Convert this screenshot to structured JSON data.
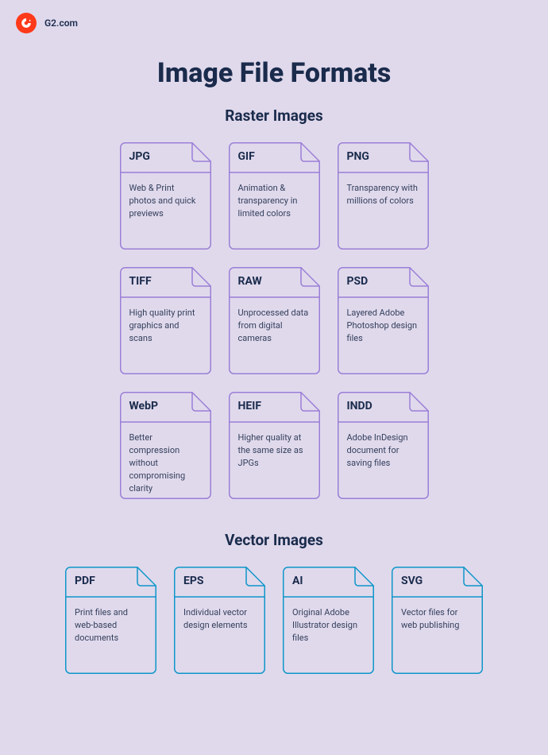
{
  "brand": "G2.com",
  "page_title": "Image File Formats",
  "sections": {
    "raster": {
      "title": "Raster Images",
      "color": "#9a7fd6",
      "cards": [
        {
          "code": "JPG",
          "desc": "Web & Print photos and quick previews"
        },
        {
          "code": "GIF",
          "desc": "Animation & transparency in limited colors"
        },
        {
          "code": "PNG",
          "desc": "Transparency with millions of colors"
        },
        {
          "code": "TIFF",
          "desc": "High quality print graphics and scans"
        },
        {
          "code": "RAW",
          "desc": "Unprocessed data from digital cameras"
        },
        {
          "code": "PSD",
          "desc": "Layered Adobe Photoshop design files"
        },
        {
          "code": "WebP",
          "desc": "Better compression without compromising clarity"
        },
        {
          "code": "HEIF",
          "desc": "Higher quality at the same size as JPGs"
        },
        {
          "code": "INDD",
          "desc": "Adobe InDesign document for saving files"
        }
      ]
    },
    "vector": {
      "title": "Vector Images",
      "color": "#0e96c9",
      "cards": [
        {
          "code": "PDF",
          "desc": "Print files and web-based documents"
        },
        {
          "code": "EPS",
          "desc": "Individual vector design elements"
        },
        {
          "code": "AI",
          "desc": "Original Adobe Illustrator design files"
        },
        {
          "code": "SVG",
          "desc": "Vector files for web publishing"
        }
      ]
    }
  }
}
